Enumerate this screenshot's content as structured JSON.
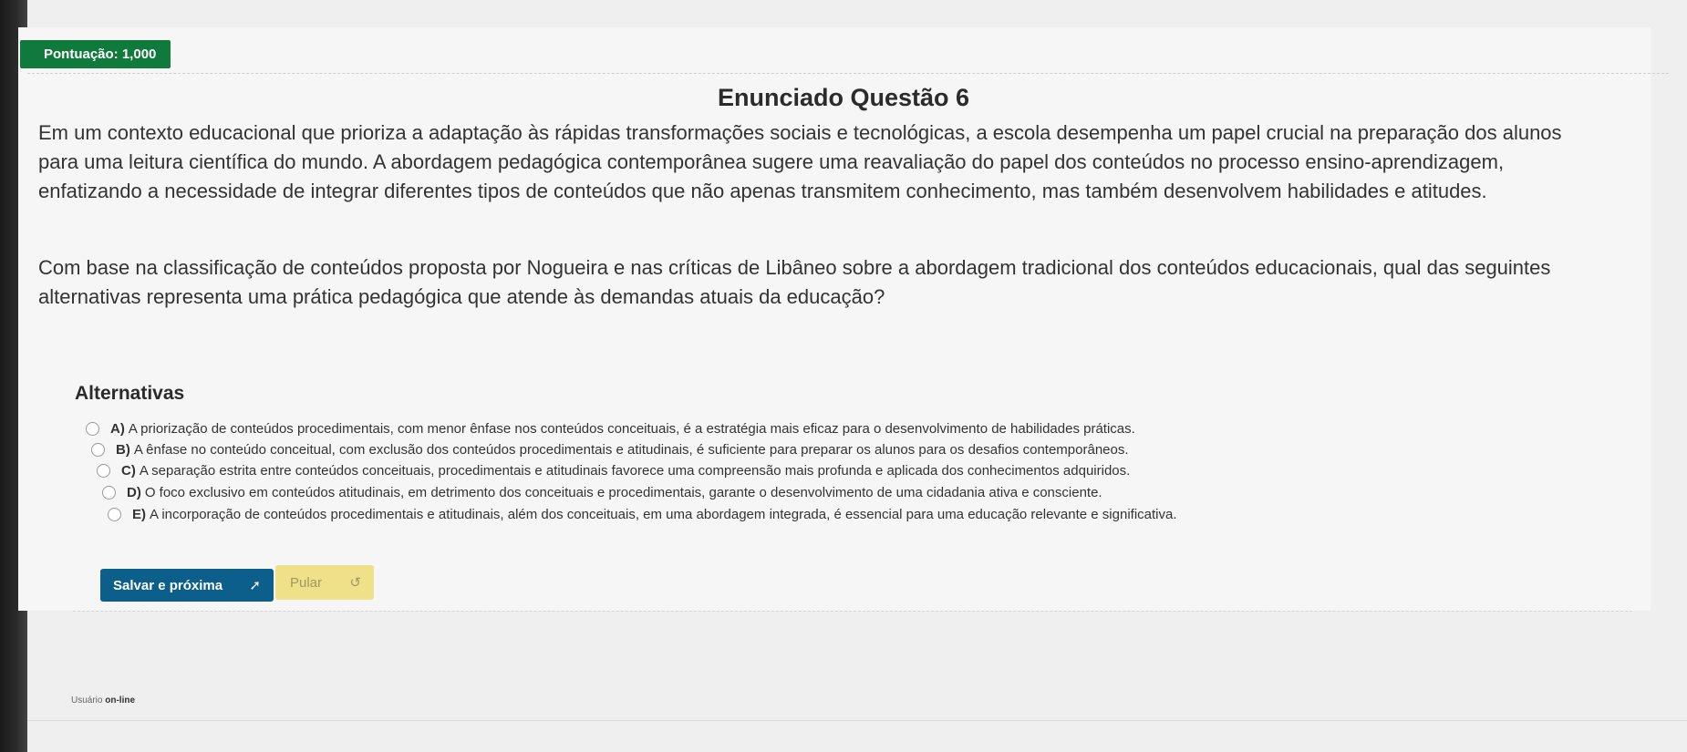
{
  "score": {
    "label": "Pontuação: 1,000"
  },
  "question": {
    "title": "Enunciado Questão 6",
    "paragraph1": [
      "Em um contexto educacional que prioriza a adaptação às rápidas transformações sociais e tecnológicas, a escola desempenha um papel crucial na preparação dos alunos",
      "para uma leitura científica do mundo. A abordagem pedagógica contemporânea sugere uma reavaliação do papel dos conteúdos no processo ensino-aprendizagem,",
      "enfatizando a necessidade de integrar diferentes tipos de conteúdos que não apenas transmitem conhecimento, mas também desenvolvem habilidades e atitudes."
    ],
    "paragraph2": [
      "Com base na classificação de conteúdos proposta por Nogueira e nas críticas de Libâneo sobre a abordagem tradicional dos conteúdos educacionais, qual das seguintes",
      "alternativas representa uma prática pedagógica que atende às demandas atuais da educação?"
    ]
  },
  "alternatives": {
    "title": "Alternativas",
    "options": [
      {
        "letter": "A)",
        "text": "A priorização de conteúdos procedimentais, com menor ênfase nos conteúdos conceituais, é a estratégia mais eficaz para o desenvolvimento de habilidades práticas."
      },
      {
        "letter": "B)",
        "text": "A ênfase no conteúdo conceitual, com exclusão dos conteúdos procedimentais e atitudinais, é suficiente para preparar os alunos para os desafios contemporâneos."
      },
      {
        "letter": "C)",
        "text": "A separação estrita entre conteúdos conceituais, procedimentais e atitudinais favorece uma compreensão mais profunda e aplicada dos conhecimentos adquiridos."
      },
      {
        "letter": "D)",
        "text": "O foco exclusivo em conteúdos atitudinais, em detrimento dos conceituais e procedimentais, garante o desenvolvimento de uma cidadania ativa e consciente."
      },
      {
        "letter": "E)",
        "text": "A incorporação de conteúdos procedimentais e atitudinais, além dos conceituais, em uma abordagem integrada, é essencial para uma educação relevante e significativa."
      }
    ]
  },
  "actions": {
    "save_label": "Salvar e próxima",
    "save_icon": "➚",
    "skip_label": "Pular",
    "skip_icon": "↺"
  },
  "status": {
    "prefix": "Usuário",
    "state": "on-line"
  }
}
